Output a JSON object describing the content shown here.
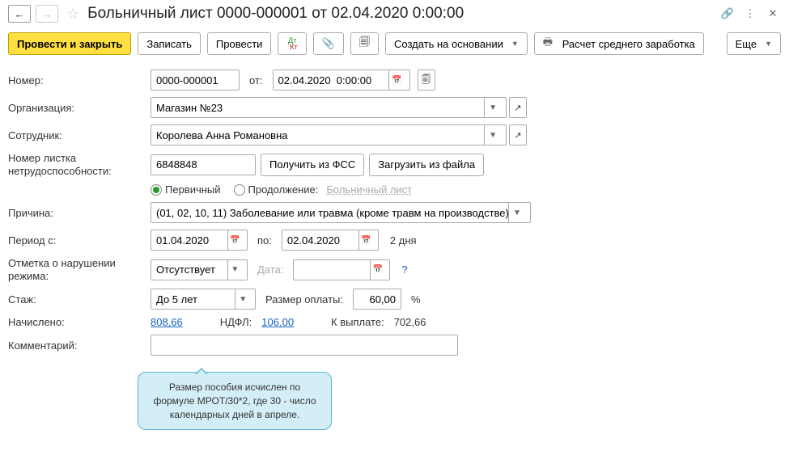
{
  "title": "Больничный лист 0000-000001 от 02.04.2020 0:00:00",
  "toolbar": {
    "post_close": "Провести и закрыть",
    "write": "Записать",
    "post": "Провести",
    "create_based": "Создать на основании",
    "calc_avg": "Расчет среднего заработка",
    "more": "Еще"
  },
  "labels": {
    "number": "Номер:",
    "from": "от:",
    "org": "Организация:",
    "employee": "Сотрудник:",
    "sheet_no": "Номер листка нетрудоспособности:",
    "get_fss": "Получить из ФСС",
    "load_file": "Загрузить из файла",
    "primary": "Первичный",
    "continuation": "Продолжение:",
    "sick_sheet": "Больничный лист",
    "reason": "Причина:",
    "period_from": "Период с:",
    "to": "по:",
    "days": "2 дня",
    "violation": "Отметка о нарушении режима:",
    "date": "Дата:",
    "seniority": "Стаж:",
    "pay_rate": "Размер оплаты:",
    "percent": "%",
    "accrued": "Начислено:",
    "ndfl": "НДФЛ:",
    "payout": "К выплате:",
    "comment": "Комментарий:"
  },
  "values": {
    "number": "0000-000001",
    "date": "02.04.2020  0:00:00",
    "org": "Магазин №23",
    "employee": "Королева Анна Романовна",
    "sheet_no": "6848848",
    "reason": "(01, 02, 10, 11) Заболевание или травма (кроме травм на производстве)",
    "period_from": "01.04.2020",
    "period_to": "02.04.2020",
    "violation": "Отсутствует",
    "violation_date": "",
    "seniority": "До 5 лет",
    "pay_rate": "60,00",
    "accrued": "808,66",
    "ndfl": "106,00",
    "payout": "702,66",
    "comment": ""
  },
  "tooltip": "Размер пособия исчислен по формуле МРОТ/30*2, где 30 - число календарных дней в апреле."
}
